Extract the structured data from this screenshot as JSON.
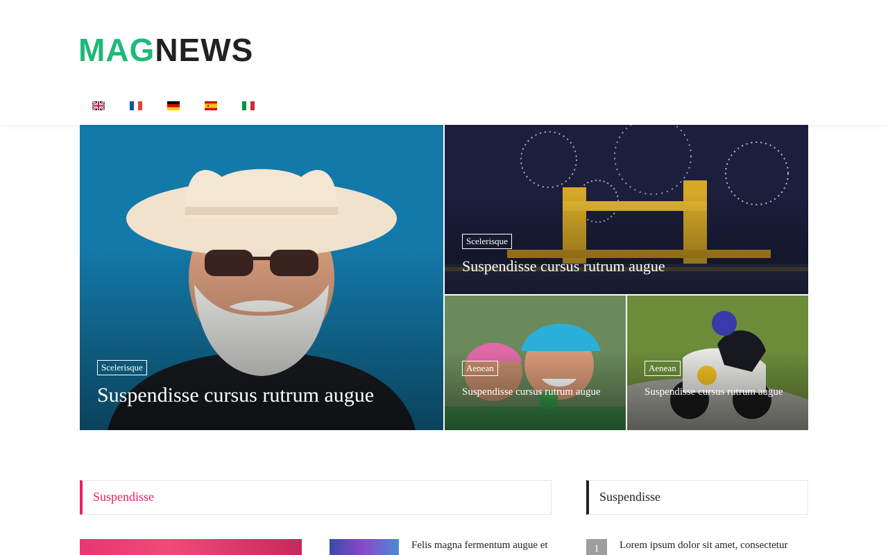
{
  "header": {
    "logo_primary": "MAG",
    "logo_secondary": "NEWS",
    "languages": [
      "English",
      "Français",
      "Deutsch",
      "Español",
      "Italiano"
    ]
  },
  "hero": {
    "main": {
      "category": "Scelerisque",
      "title": "Suspendisse cursus rutrum augue"
    },
    "top": {
      "category": "Scelerisque",
      "title": "Suspendisse cursus rutrum augue"
    },
    "bottom_left": {
      "category": "Aenean",
      "title": "Suspendisse cursus rutrum augue"
    },
    "bottom_right": {
      "category": "Aenean",
      "title": "Suspendisse cursus rutrum augue"
    }
  },
  "main_section": {
    "heading": "Suspendisse",
    "small_post_title": "Felis magna fermentum augue et"
  },
  "sidebar": {
    "heading": "Suspendisse",
    "items": [
      {
        "rank": "1",
        "title": "Lorem ipsum dolor sit amet, consectetur"
      }
    ]
  },
  "colors": {
    "brand_green": "#1fb978",
    "accent_pink": "#e91e63",
    "rank_gray": "#9e9e9e"
  }
}
